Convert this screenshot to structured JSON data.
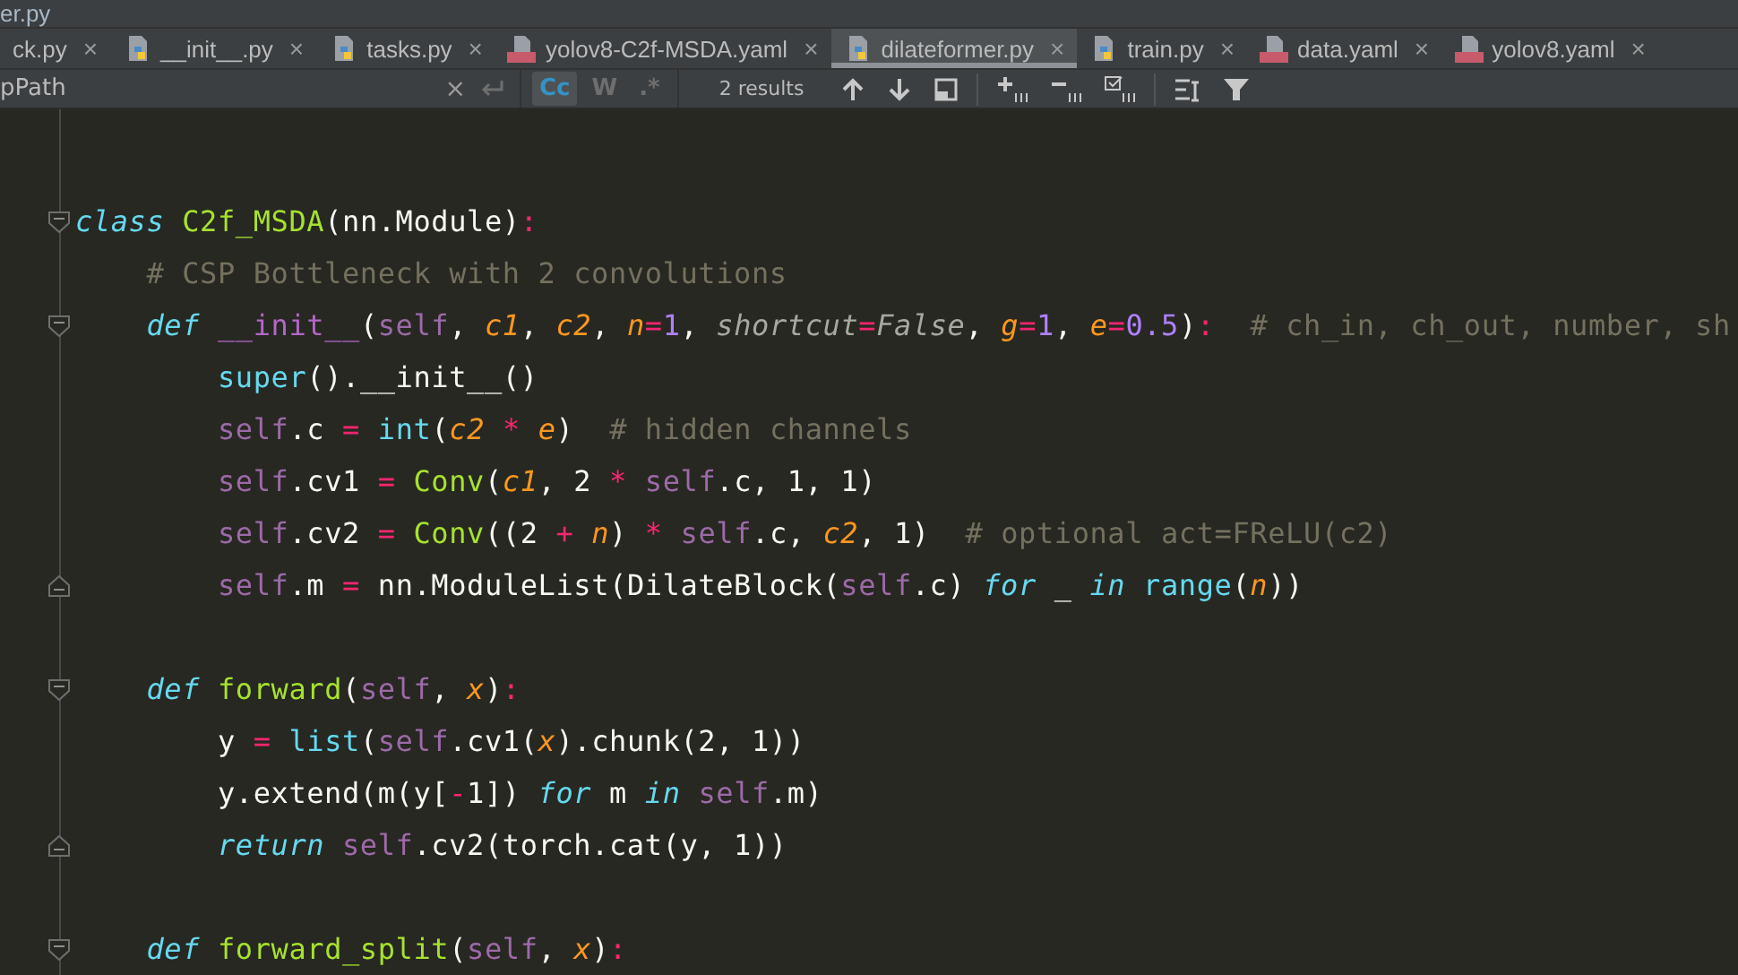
{
  "window": {
    "title": "er.py"
  },
  "tabs": [
    {
      "label": "ck.py",
      "close": "×",
      "selected": false
    },
    {
      "label": "__init__.py",
      "kind": "python",
      "close": "×",
      "selected": false
    },
    {
      "label": "tasks.py",
      "kind": "python",
      "close": "×",
      "selected": false
    },
    {
      "label": "yolov8-C2f-MSDA.yaml",
      "kind": "yaml",
      "close": "×",
      "selected": false
    },
    {
      "label": "dilateformer.py",
      "kind": "python",
      "close": "×",
      "selected": true
    },
    {
      "label": "train.py",
      "kind": "python",
      "close": "×",
      "selected": false
    },
    {
      "label": "data.yaml",
      "kind": "yaml",
      "close": "×",
      "selected": false
    },
    {
      "label": "yolov8.yaml",
      "kind": "yaml",
      "close": "×",
      "selected": false
    }
  ],
  "search": {
    "value": "pPath",
    "clear": "×",
    "toggles": [
      {
        "label": "Cc",
        "selected": true
      },
      {
        "label": "W",
        "selected": false
      },
      {
        "label": ".*",
        "selected": false
      }
    ],
    "results": "2 results"
  },
  "code": [
    {
      "kind": "blank"
    },
    {
      "kind": "fold_open",
      "tokens": [
        {
          "text": "class ",
          "kind": "kw"
        },
        {
          "text": "C2f_MSDA",
          "kind": "cls"
        },
        {
          "text": "(nn.Module)",
          "kind": "txt"
        },
        {
          "text": ":",
          "kind": "op"
        }
      ]
    },
    {
      "kind": "plain",
      "tokens": [
        {
          "text": "    # CSP Bottleneck with 2 convolutions",
          "kind": "cmt"
        }
      ]
    },
    {
      "kind": "fold_open",
      "tokens": [
        {
          "text": "    def ",
          "kind": "kw"
        },
        {
          "text": "__init__",
          "kind": "magic"
        },
        {
          "text": "(",
          "kind": "txt"
        },
        {
          "text": "self",
          "kind": "self"
        },
        {
          "text": ", ",
          "kind": "txt"
        },
        {
          "text": "c1",
          "kind": "param"
        },
        {
          "text": ", ",
          "kind": "txt"
        },
        {
          "text": "c2",
          "kind": "param"
        },
        {
          "text": ", ",
          "kind": "txt"
        },
        {
          "text": "n",
          "kind": "param"
        },
        {
          "text": "=",
          "kind": "op"
        },
        {
          "text": "1",
          "kind": "num"
        },
        {
          "text": ", ",
          "kind": "txt"
        },
        {
          "text": "shortcut",
          "kind": "kwarg"
        },
        {
          "text": "=",
          "kind": "op"
        },
        {
          "text": "False",
          "kind": "kwarg"
        },
        {
          "text": ", ",
          "kind": "txt"
        },
        {
          "text": "g",
          "kind": "param"
        },
        {
          "text": "=",
          "kind": "op"
        },
        {
          "text": "1",
          "kind": "num"
        },
        {
          "text": ", ",
          "kind": "txt"
        },
        {
          "text": "e",
          "kind": "param"
        },
        {
          "text": "=",
          "kind": "op"
        },
        {
          "text": "0.5",
          "kind": "num"
        },
        {
          "text": ")",
          "kind": "txt"
        },
        {
          "text": ":",
          "kind": "op"
        },
        {
          "text": "  # ch_in, ch_out, number, sh",
          "kind": "cmt"
        }
      ]
    },
    {
      "kind": "plain",
      "tokens": [
        {
          "text": "        super",
          "kind": "builtin"
        },
        {
          "text": "().__init__()",
          "kind": "txt"
        }
      ]
    },
    {
      "kind": "plain",
      "tokens": [
        {
          "text": "        self",
          "kind": "self"
        },
        {
          "text": ".c ",
          "kind": "txt"
        },
        {
          "text": "= ",
          "kind": "op"
        },
        {
          "text": "int",
          "kind": "builtin"
        },
        {
          "text": "(",
          "kind": "txt"
        },
        {
          "text": "c2",
          "kind": "param"
        },
        {
          "text": " * ",
          "kind": "op"
        },
        {
          "text": "e",
          "kind": "param"
        },
        {
          "text": ")",
          "kind": "txt"
        },
        {
          "text": "  # hidden channels",
          "kind": "cmt"
        }
      ]
    },
    {
      "kind": "plain",
      "tokens": [
        {
          "text": "        self",
          "kind": "self"
        },
        {
          "text": ".cv1 ",
          "kind": "txt"
        },
        {
          "text": "= ",
          "kind": "op"
        },
        {
          "text": "Conv",
          "kind": "fn"
        },
        {
          "text": "(",
          "kind": "txt"
        },
        {
          "text": "c1",
          "kind": "param"
        },
        {
          "text": ", 2 ",
          "kind": "txt"
        },
        {
          "text": "* ",
          "kind": "op"
        },
        {
          "text": "self",
          "kind": "self"
        },
        {
          "text": ".c, 1, 1)",
          "kind": "txt"
        }
      ]
    },
    {
      "kind": "plain",
      "tokens": [
        {
          "text": "        self",
          "kind": "self"
        },
        {
          "text": ".cv2 ",
          "kind": "txt"
        },
        {
          "text": "= ",
          "kind": "op"
        },
        {
          "text": "Conv",
          "kind": "fn"
        },
        {
          "text": "((2 ",
          "kind": "txt"
        },
        {
          "text": "+ ",
          "kind": "op"
        },
        {
          "text": "n",
          "kind": "param"
        },
        {
          "text": ") ",
          "kind": "txt"
        },
        {
          "text": "* ",
          "kind": "op"
        },
        {
          "text": "self",
          "kind": "self"
        },
        {
          "text": ".c, ",
          "kind": "txt"
        },
        {
          "text": "c2",
          "kind": "param"
        },
        {
          "text": ", 1)",
          "kind": "txt"
        },
        {
          "text": "  # optional act=FReLU(c2)",
          "kind": "cmt"
        }
      ]
    },
    {
      "kind": "fold_close",
      "tokens": [
        {
          "text": "        self",
          "kind": "self"
        },
        {
          "text": ".m ",
          "kind": "txt"
        },
        {
          "text": "=",
          "kind": "op"
        },
        {
          "text": " nn.ModuleList(DilateBlock(",
          "kind": "txt"
        },
        {
          "text": "self",
          "kind": "self"
        },
        {
          "text": ".c) ",
          "kind": "txt"
        },
        {
          "text": "for",
          "kind": "kw"
        },
        {
          "text": " _ ",
          "kind": "txt"
        },
        {
          "text": "in ",
          "kind": "kw"
        },
        {
          "text": "range",
          "kind": "builtin"
        },
        {
          "text": "(",
          "kind": "txt"
        },
        {
          "text": "n",
          "kind": "param"
        },
        {
          "text": "))",
          "kind": "txt"
        }
      ]
    },
    {
      "kind": "blank"
    },
    {
      "kind": "fold_open",
      "tokens": [
        {
          "text": "    def ",
          "kind": "kw"
        },
        {
          "text": "forward",
          "kind": "fn"
        },
        {
          "text": "(",
          "kind": "txt"
        },
        {
          "text": "self",
          "kind": "self"
        },
        {
          "text": ", ",
          "kind": "txt"
        },
        {
          "text": "x",
          "kind": "param"
        },
        {
          "text": ")",
          "kind": "txt"
        },
        {
          "text": ":",
          "kind": "op"
        }
      ]
    },
    {
      "kind": "plain",
      "tokens": [
        {
          "text": "        y ",
          "kind": "txt"
        },
        {
          "text": "= ",
          "kind": "op"
        },
        {
          "text": "list",
          "kind": "builtin"
        },
        {
          "text": "(",
          "kind": "txt"
        },
        {
          "text": "self",
          "kind": "self"
        },
        {
          "text": ".cv1(",
          "kind": "txt"
        },
        {
          "text": "x",
          "kind": "param"
        },
        {
          "text": ").chunk(2, 1))",
          "kind": "txt"
        }
      ]
    },
    {
      "kind": "plain",
      "tokens": [
        {
          "text": "        y.extend(m(y[",
          "kind": "txt"
        },
        {
          "text": "-",
          "kind": "op"
        },
        {
          "text": "1]) ",
          "kind": "txt"
        },
        {
          "text": "for",
          "kind": "kw"
        },
        {
          "text": " m ",
          "kind": "txt"
        },
        {
          "text": "in ",
          "kind": "kw"
        },
        {
          "text": "self",
          "kind": "self"
        },
        {
          "text": ".m)",
          "kind": "txt"
        }
      ]
    },
    {
      "kind": "fold_close",
      "tokens": [
        {
          "text": "        return ",
          "kind": "kw"
        },
        {
          "text": "self",
          "kind": "self"
        },
        {
          "text": ".cv2(torch.cat(y, 1))",
          "kind": "txt"
        }
      ]
    },
    {
      "kind": "blank"
    },
    {
      "kind": "fold_open",
      "tokens": [
        {
          "text": "    def ",
          "kind": "kw"
        },
        {
          "text": "forward_split",
          "kind": "fn"
        },
        {
          "text": "(",
          "kind": "txt"
        },
        {
          "text": "self",
          "kind": "self"
        },
        {
          "text": ", ",
          "kind": "txt"
        },
        {
          "text": "x",
          "kind": "param"
        },
        {
          "text": ")",
          "kind": "txt"
        },
        {
          "text": ":",
          "kind": "op"
        }
      ]
    }
  ]
}
